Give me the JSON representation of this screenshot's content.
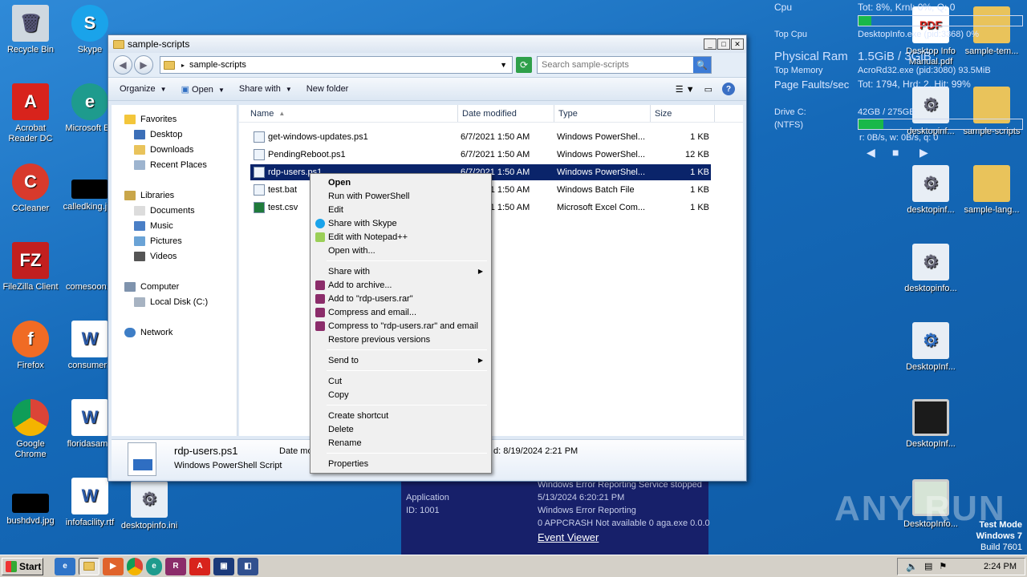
{
  "desktop": {
    "left_icons": [
      {
        "label": "Recycle Bin",
        "icon": "recycle-bin-icon"
      },
      {
        "label": "Skype",
        "icon": "skype-icon"
      },
      {
        "label": "Acrobat Reader DC",
        "icon": "acrobat-icon"
      },
      {
        "label": "Microsoft Ed",
        "icon": "edge-icon"
      },
      {
        "label": "CCleaner",
        "icon": "ccleaner-icon"
      },
      {
        "label": "calledking.jpg",
        "icon": "image-file-icon"
      },
      {
        "label": "FileZilla Client",
        "icon": "filezilla-icon"
      },
      {
        "label": "comesoon.p",
        "icon": "file-icon"
      },
      {
        "label": "Firefox",
        "icon": "firefox-icon"
      },
      {
        "label": "consumerb",
        "icon": "word-doc-icon"
      },
      {
        "label": "Google Chrome",
        "icon": "chrome-icon"
      },
      {
        "label": "floridasame",
        "icon": "word-doc-icon"
      },
      {
        "label": "bushdvd.jpg",
        "icon": "image-file-icon"
      },
      {
        "label": "infofacility.rtf",
        "icon": "word-doc-icon"
      },
      {
        "label": "desktopinfo.ini",
        "icon": "settings-file-icon"
      }
    ],
    "right_icons": [
      {
        "label": "Desktop Info Manual.pdf",
        "icon": "pdf-icon"
      },
      {
        "label": "sample-tem...",
        "icon": "folder-icon"
      },
      {
        "label": "desktopinf...",
        "icon": "settings-file-icon"
      },
      {
        "label": "sample-scripts",
        "icon": "folder-icon"
      },
      {
        "label": "desktopinf...",
        "icon": "settings-file-icon"
      },
      {
        "label": "sample-lang...",
        "icon": "folder-icon"
      },
      {
        "label": "desktopinfo...",
        "icon": "settings-file-icon"
      },
      {
        "label": "DesktopInf...",
        "icon": "settings-file-icon"
      },
      {
        "label": "DesktopInf...",
        "icon": "monitor-icon"
      },
      {
        "label": "DesktopInfo...",
        "icon": "monitor-icon"
      }
    ]
  },
  "sysinfo": {
    "cpu_label": "Cpu",
    "cpu_value": "Tot: 8%, Krnl: 0%, Q: 0",
    "cpu_fill": 0.08,
    "top_cpu_label": "Top Cpu",
    "top_cpu_value": "DesktopInfo.exe (pid:3368) 0%",
    "ram_label": "Physical Ram",
    "ram_value": "1.5GiB / 3GiB",
    "top_mem_label": "Top Memory",
    "top_mem_value": "AcroRd32.exe (pid:3080) 93.5MiB",
    "pf_label": "Page Faults/sec",
    "pf_value": "Tot: 1794, Hrd: 2, Hit: 99%",
    "drive_label": "Drive C:",
    "drive_fs": "(NTFS)",
    "drive_value": "42GB / 275GB",
    "drive_fill": 0.15,
    "drive_io": "r: 0B/s, w: 0B/s, q: 0"
  },
  "window": {
    "title": "sample-scripts",
    "address": "sample-scripts",
    "search_placeholder": "Search sample-scripts",
    "toolbar": {
      "organize": "Organize",
      "open": "Open",
      "share_with": "Share with",
      "new_folder": "New folder"
    },
    "nav": {
      "favorites": "Favorites",
      "desktop": "Desktop",
      "downloads": "Downloads",
      "recent": "Recent Places",
      "libraries": "Libraries",
      "documents": "Documents",
      "music": "Music",
      "pictures": "Pictures",
      "videos": "Videos",
      "computer": "Computer",
      "local_disk": "Local Disk (C:)",
      "network": "Network"
    },
    "columns": {
      "name": "Name",
      "date": "Date modified",
      "type": "Type",
      "size": "Size"
    },
    "files": [
      {
        "name": "get-windows-updates.ps1",
        "date": "6/7/2021 1:50 AM",
        "type": "Windows PowerShel...",
        "size": "1 KB"
      },
      {
        "name": "PendingReboot.ps1",
        "date": "6/7/2021 1:50 AM",
        "type": "Windows PowerShel...",
        "size": "12 KB"
      },
      {
        "name": "rdp-users.ps1",
        "date": "6/7/2021 1:50 AM",
        "type": "Windows PowerShel...",
        "size": "1 KB"
      },
      {
        "name": "test.bat",
        "date": "6/7/2021 1:50 AM",
        "type": "Windows Batch File",
        "size": "1 KB"
      },
      {
        "name": "test.csv",
        "date": "6/7/2021 1:50 AM",
        "type": "Microsoft Excel Com...",
        "size": "1 KB"
      }
    ],
    "details": {
      "name": "rdp-users.ps1",
      "type": "Windows PowerShell Script",
      "date_label": "Date mo",
      "created_value": "d: 8/19/2024 2:21 PM"
    }
  },
  "context_menu": {
    "open": "Open",
    "run_ps": "Run with PowerShell",
    "edit": "Edit",
    "share_skype": "Share with Skype",
    "edit_npp": "Edit with Notepad++",
    "open_with": "Open with...",
    "share_with": "Share with",
    "add_archive": "Add to archive...",
    "add_rar": "Add to \"rdp-users.rar\"",
    "compress_email": "Compress and email...",
    "compress_rar_email": "Compress to \"rdp-users.rar\" and email",
    "restore": "Restore previous versions",
    "send_to": "Send to",
    "cut": "Cut",
    "copy": "Copy",
    "create_shortcut": "Create shortcut",
    "delete": "Delete",
    "rename": "Rename",
    "properties": "Properties"
  },
  "event_panel": {
    "line1": "Windows Error Reporting Service stopped",
    "app_label": "Application",
    "app_date": "5/13/2024 6:20:21 PM",
    "id_label": "ID: 1001",
    "source": "Windows Error Reporting",
    "detail": "0 APPCRASH Not available 0 aga.exe 0.0.0",
    "link": "Event Viewer"
  },
  "watermark": "ANY RUN",
  "test_mode": {
    "line1": "Test Mode",
    "line2": "Windows 7",
    "line3": "Build 7601"
  },
  "taskbar": {
    "start": "Start",
    "clock": "2:24 PM"
  }
}
